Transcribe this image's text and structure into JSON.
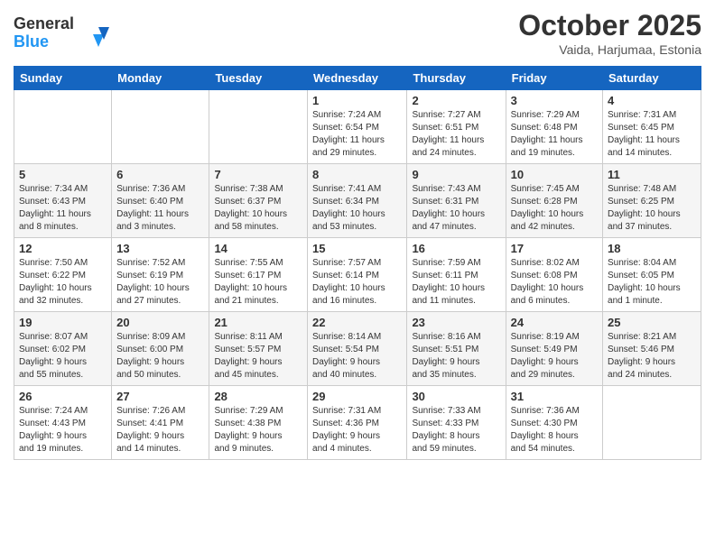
{
  "header": {
    "logo_line1": "General",
    "logo_line2": "Blue",
    "month": "October 2025",
    "location": "Vaida, Harjumaa, Estonia"
  },
  "days_of_week": [
    "Sunday",
    "Monday",
    "Tuesday",
    "Wednesday",
    "Thursday",
    "Friday",
    "Saturday"
  ],
  "weeks": [
    [
      {
        "day": "",
        "info": ""
      },
      {
        "day": "",
        "info": ""
      },
      {
        "day": "",
        "info": ""
      },
      {
        "day": "1",
        "info": "Sunrise: 7:24 AM\nSunset: 6:54 PM\nDaylight: 11 hours\nand 29 minutes."
      },
      {
        "day": "2",
        "info": "Sunrise: 7:27 AM\nSunset: 6:51 PM\nDaylight: 11 hours\nand 24 minutes."
      },
      {
        "day": "3",
        "info": "Sunrise: 7:29 AM\nSunset: 6:48 PM\nDaylight: 11 hours\nand 19 minutes."
      },
      {
        "day": "4",
        "info": "Sunrise: 7:31 AM\nSunset: 6:45 PM\nDaylight: 11 hours\nand 14 minutes."
      }
    ],
    [
      {
        "day": "5",
        "info": "Sunrise: 7:34 AM\nSunset: 6:43 PM\nDaylight: 11 hours\nand 8 minutes."
      },
      {
        "day": "6",
        "info": "Sunrise: 7:36 AM\nSunset: 6:40 PM\nDaylight: 11 hours\nand 3 minutes."
      },
      {
        "day": "7",
        "info": "Sunrise: 7:38 AM\nSunset: 6:37 PM\nDaylight: 10 hours\nand 58 minutes."
      },
      {
        "day": "8",
        "info": "Sunrise: 7:41 AM\nSunset: 6:34 PM\nDaylight: 10 hours\nand 53 minutes."
      },
      {
        "day": "9",
        "info": "Sunrise: 7:43 AM\nSunset: 6:31 PM\nDaylight: 10 hours\nand 47 minutes."
      },
      {
        "day": "10",
        "info": "Sunrise: 7:45 AM\nSunset: 6:28 PM\nDaylight: 10 hours\nand 42 minutes."
      },
      {
        "day": "11",
        "info": "Sunrise: 7:48 AM\nSunset: 6:25 PM\nDaylight: 10 hours\nand 37 minutes."
      }
    ],
    [
      {
        "day": "12",
        "info": "Sunrise: 7:50 AM\nSunset: 6:22 PM\nDaylight: 10 hours\nand 32 minutes."
      },
      {
        "day": "13",
        "info": "Sunrise: 7:52 AM\nSunset: 6:19 PM\nDaylight: 10 hours\nand 27 minutes."
      },
      {
        "day": "14",
        "info": "Sunrise: 7:55 AM\nSunset: 6:17 PM\nDaylight: 10 hours\nand 21 minutes."
      },
      {
        "day": "15",
        "info": "Sunrise: 7:57 AM\nSunset: 6:14 PM\nDaylight: 10 hours\nand 16 minutes."
      },
      {
        "day": "16",
        "info": "Sunrise: 7:59 AM\nSunset: 6:11 PM\nDaylight: 10 hours\nand 11 minutes."
      },
      {
        "day": "17",
        "info": "Sunrise: 8:02 AM\nSunset: 6:08 PM\nDaylight: 10 hours\nand 6 minutes."
      },
      {
        "day": "18",
        "info": "Sunrise: 8:04 AM\nSunset: 6:05 PM\nDaylight: 10 hours\nand 1 minute."
      }
    ],
    [
      {
        "day": "19",
        "info": "Sunrise: 8:07 AM\nSunset: 6:02 PM\nDaylight: 9 hours\nand 55 minutes."
      },
      {
        "day": "20",
        "info": "Sunrise: 8:09 AM\nSunset: 6:00 PM\nDaylight: 9 hours\nand 50 minutes."
      },
      {
        "day": "21",
        "info": "Sunrise: 8:11 AM\nSunset: 5:57 PM\nDaylight: 9 hours\nand 45 minutes."
      },
      {
        "day": "22",
        "info": "Sunrise: 8:14 AM\nSunset: 5:54 PM\nDaylight: 9 hours\nand 40 minutes."
      },
      {
        "day": "23",
        "info": "Sunrise: 8:16 AM\nSunset: 5:51 PM\nDaylight: 9 hours\nand 35 minutes."
      },
      {
        "day": "24",
        "info": "Sunrise: 8:19 AM\nSunset: 5:49 PM\nDaylight: 9 hours\nand 29 minutes."
      },
      {
        "day": "25",
        "info": "Sunrise: 8:21 AM\nSunset: 5:46 PM\nDaylight: 9 hours\nand 24 minutes."
      }
    ],
    [
      {
        "day": "26",
        "info": "Sunrise: 7:24 AM\nSunset: 4:43 PM\nDaylight: 9 hours\nand 19 minutes."
      },
      {
        "day": "27",
        "info": "Sunrise: 7:26 AM\nSunset: 4:41 PM\nDaylight: 9 hours\nand 14 minutes."
      },
      {
        "day": "28",
        "info": "Sunrise: 7:29 AM\nSunset: 4:38 PM\nDaylight: 9 hours\nand 9 minutes."
      },
      {
        "day": "29",
        "info": "Sunrise: 7:31 AM\nSunset: 4:36 PM\nDaylight: 9 hours\nand 4 minutes."
      },
      {
        "day": "30",
        "info": "Sunrise: 7:33 AM\nSunset: 4:33 PM\nDaylight: 8 hours\nand 59 minutes."
      },
      {
        "day": "31",
        "info": "Sunrise: 7:36 AM\nSunset: 4:30 PM\nDaylight: 8 hours\nand 54 minutes."
      },
      {
        "day": "",
        "info": ""
      }
    ]
  ]
}
